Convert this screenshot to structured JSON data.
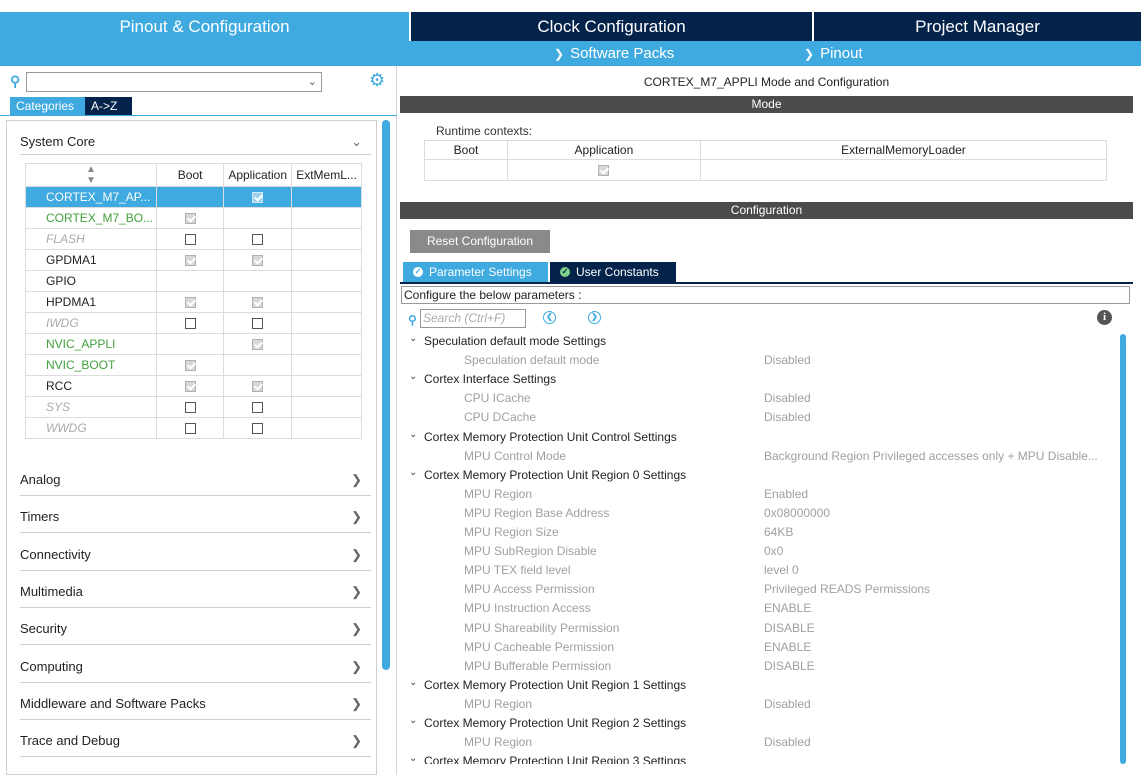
{
  "top_tabs": {
    "pinout_config": "Pinout & Configuration",
    "clock_config": "Clock Configuration",
    "project_manager": "Project Manager"
  },
  "sub_menu": {
    "software_packs": "Software Packs",
    "pinout": "Pinout"
  },
  "left": {
    "search": {
      "value": ""
    },
    "tabs": {
      "categories": "Categories",
      "az": "A->Z"
    },
    "system_core": {
      "title": "System Core",
      "columns": [
        "",
        "Boot",
        "Application",
        "ExtMemL..."
      ],
      "rows": [
        {
          "name": "CORTEX_M7_AP...",
          "boot": "",
          "application": "checked",
          "ext": "",
          "style": "selected"
        },
        {
          "name": "CORTEX_M7_BO...",
          "boot": "checked",
          "application": "",
          "ext": "",
          "style": "green"
        },
        {
          "name": "FLASH",
          "boot": "unchecked",
          "application": "unchecked",
          "ext": "",
          "style": "italic"
        },
        {
          "name": "GPDMA1",
          "boot": "checked",
          "application": "checked",
          "ext": "",
          "style": "normal"
        },
        {
          "name": "GPIO",
          "boot": "",
          "application": "",
          "ext": "",
          "style": "normal"
        },
        {
          "name": "HPDMA1",
          "boot": "checked",
          "application": "checked",
          "ext": "",
          "style": "normal"
        },
        {
          "name": "IWDG",
          "boot": "unchecked",
          "application": "unchecked",
          "ext": "",
          "style": "italic"
        },
        {
          "name": "NVIC_APPLI",
          "boot": "",
          "application": "checked",
          "ext": "",
          "style": "green"
        },
        {
          "name": "NVIC_BOOT",
          "boot": "checked",
          "application": "",
          "ext": "",
          "style": "green"
        },
        {
          "name": "RCC",
          "boot": "checked",
          "application": "checked",
          "ext": "",
          "style": "normal"
        },
        {
          "name": "SYS",
          "boot": "unchecked",
          "application": "unchecked",
          "ext": "",
          "style": "italic"
        },
        {
          "name": "WWDG",
          "boot": "unchecked",
          "application": "unchecked",
          "ext": "",
          "style": "italic"
        }
      ]
    },
    "categories": [
      "Analog",
      "Timers",
      "Connectivity",
      "Multimedia",
      "Security",
      "Computing",
      "Middleware and Software Packs",
      "Trace and Debug"
    ]
  },
  "right": {
    "title": "CORTEX_M7_APPLI Mode and Configuration",
    "mode_header": "Mode",
    "runtime_label": "Runtime contexts:",
    "runtime_columns": [
      "Boot",
      "Application",
      "ExternalMemoryLoader"
    ],
    "runtime_values": {
      "boot": "",
      "application": "checked",
      "ext": ""
    },
    "config_header": "Configuration",
    "reset_button": "Reset Configuration",
    "tabs": {
      "parameter": "Parameter Settings",
      "user_constants": "User Constants"
    },
    "configure_text": "Configure the below parameters :",
    "search_placeholder": "Search (Ctrl+F)",
    "params": [
      {
        "type": "group",
        "name": "Speculation default mode Settings"
      },
      {
        "type": "item",
        "name": "Speculation default mode",
        "value": "Disabled"
      },
      {
        "type": "group",
        "name": "Cortex Interface Settings"
      },
      {
        "type": "item",
        "name": "CPU ICache",
        "value": "Disabled"
      },
      {
        "type": "item",
        "name": "CPU DCache",
        "value": "Disabled"
      },
      {
        "type": "group",
        "name": "Cortex Memory Protection Unit Control Settings"
      },
      {
        "type": "item",
        "name": "MPU Control Mode",
        "value": "Background Region Privileged accesses only + MPU Disable..."
      },
      {
        "type": "group",
        "name": "Cortex Memory Protection Unit Region 0 Settings"
      },
      {
        "type": "item",
        "name": "MPU Region",
        "value": "Enabled"
      },
      {
        "type": "item",
        "name": "MPU Region Base Address",
        "value": "0x08000000"
      },
      {
        "type": "item",
        "name": "MPU Region Size",
        "value": "64KB"
      },
      {
        "type": "item",
        "name": "MPU SubRegion Disable",
        "value": "0x0"
      },
      {
        "type": "item",
        "name": "MPU TEX field level",
        "value": "level 0"
      },
      {
        "type": "item",
        "name": "MPU Access Permission",
        "value": "Privileged READS Permissions"
      },
      {
        "type": "item",
        "name": "MPU Instruction Access",
        "value": "ENABLE"
      },
      {
        "type": "item",
        "name": "MPU Shareability Permission",
        "value": "DISABLE"
      },
      {
        "type": "item",
        "name": "MPU Cacheable Permission",
        "value": "ENABLE"
      },
      {
        "type": "item",
        "name": "MPU Bufferable  Permission",
        "value": "DISABLE"
      },
      {
        "type": "group",
        "name": "Cortex Memory Protection Unit Region 1 Settings"
      },
      {
        "type": "item",
        "name": "MPU Region",
        "value": "Disabled"
      },
      {
        "type": "group",
        "name": "Cortex Memory Protection Unit Region 2 Settings"
      },
      {
        "type": "item",
        "name": "MPU Region",
        "value": "Disabled"
      },
      {
        "type": "group",
        "name": "Cortex Memory Protection Unit Region 3 Settings"
      }
    ]
  },
  "colors": {
    "accent": "#3faae0",
    "dark_navy": "#03234b",
    "green_text": "#42a13d",
    "section_bar": "#4b4b4b"
  }
}
